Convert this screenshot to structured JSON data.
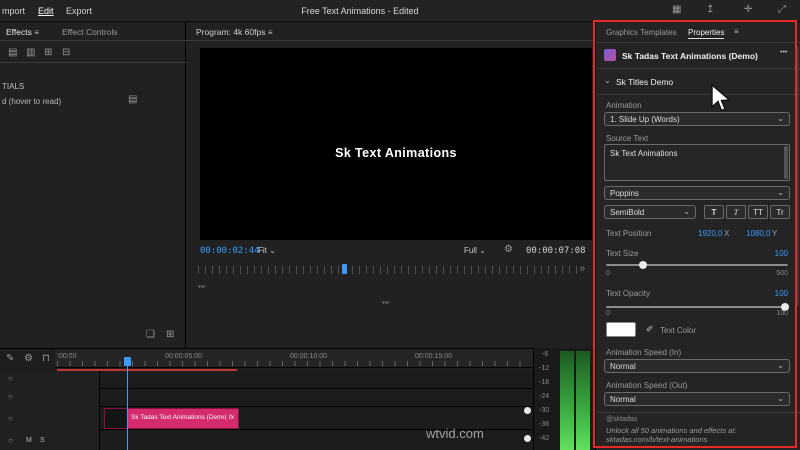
{
  "titlebar": {
    "menu_import": "mport",
    "menu_edit": "Edit",
    "menu_export": "Export",
    "title": "Free Text Animations - Edited",
    "window_icons": [
      "▦",
      "↥",
      "✛",
      "⤢"
    ]
  },
  "left_panel": {
    "tab_effects": "Effects",
    "tab_effect_controls": "Effect Controls",
    "panel_icons": [
      "▤",
      "▥",
      "⊞",
      "⊟"
    ],
    "label_tials": "TIALS",
    "label_hover": "d (hover to read)"
  },
  "program": {
    "header": "Program: 4k 60fps",
    "canvas_text": "Sk Text Animations",
    "timecode": "00:00:02:44",
    "fit_label": "Fit",
    "quality_label": "Full",
    "duration": "00:00:07:08"
  },
  "properties": {
    "tab_graphics_templates": "Graphics Templates",
    "tab_properties": "Properties",
    "clip_title": "Sk Tadas Text Animations (Demo)",
    "section_title": "Sk Titles Demo",
    "animation_label": "Animation",
    "animation_value": "1. Slide Up (Words)",
    "source_text_label": "Source Text",
    "source_text_value": "Sk Text Animations",
    "font_family": "Poppins",
    "font_weight": "SemiBold",
    "style_buttons": [
      "T",
      "T",
      "TT",
      "Tr"
    ],
    "text_position_label": "Text Position",
    "pos_x_value": "1920,0",
    "pos_x_axis": "X",
    "pos_y_value": "1080,0",
    "pos_y_axis": "Y",
    "text_size_label": "Text Size",
    "text_size_value": "100",
    "text_size_min": "0",
    "text_size_max": "500",
    "text_opacity_label": "Text Opacity",
    "text_opacity_value": "100",
    "text_opacity_min": "0",
    "text_opacity_max": "100",
    "text_color_label": "Text Color",
    "anim_speed_in_label": "Animation Speed (In)",
    "anim_speed_in_value": "Normal",
    "anim_speed_out_label": "Animation Speed (Out)",
    "anim_speed_out_value": "Normal",
    "footer_handle": "@sktadas",
    "footer_note": "Unlock all 50 animations and effects at: sktadas.com/b/text-animations"
  },
  "timeline": {
    "ruler_labels": [
      ":00:00",
      "00:00:05:00",
      "00:00:10:00",
      "00:00:15:00"
    ],
    "clip_label": "Sk Tadas Text Animations (Demo)",
    "clip_fx": "fx",
    "mute_label": "M",
    "solo_label": "S"
  },
  "audio_meter": {
    "labels": [
      "-6",
      "-12",
      "-18",
      "-24",
      "-30",
      "-36",
      "-42"
    ]
  },
  "icons": {
    "hamburger": "≡",
    "chevron_down": "⌄",
    "more": "•••",
    "wrench": "⚙",
    "circle_handle": "○",
    "folder": "❏",
    "new_item": "⊞",
    "pen": "✎",
    "snap": "⊓",
    "eyedropper": "✐",
    "grip_dots": "•••"
  },
  "colors": {
    "accent_blue": "#3a9bfc",
    "clip_pink": "#d42a6e",
    "highlight_red": "#e62a2a",
    "text_color_swatch": "#ffffff"
  },
  "watermark": "wtvid.com"
}
